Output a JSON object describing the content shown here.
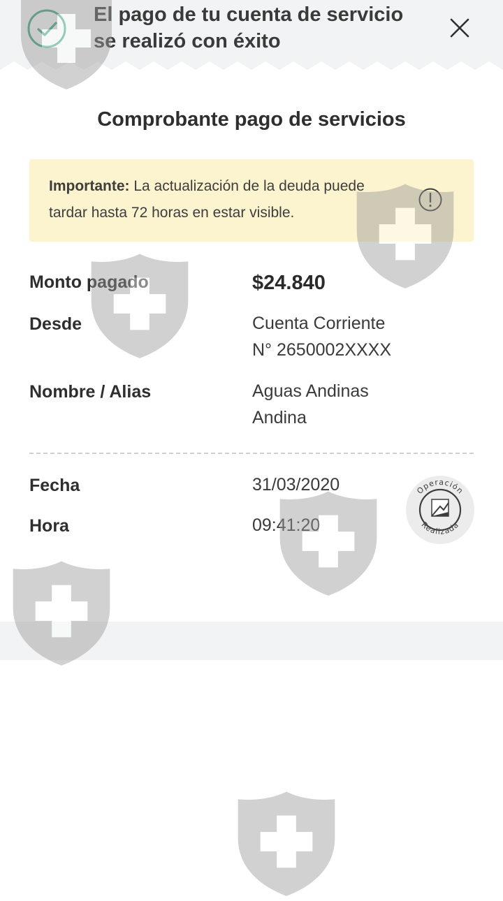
{
  "header": {
    "title_line1": "El pago de tu cuenta de servicio",
    "title_line2": "se realizó con éxito",
    "success_icon": "check-circle-icon",
    "close_icon": "close-icon"
  },
  "receipt": {
    "title": "Comprobante pago de servicios",
    "notice": {
      "bold": "Importante:",
      "text": " La actualización de la deuda puede tardar hasta 72 horas en estar visible.",
      "icon": "alert-circle-icon"
    },
    "amount": {
      "label": "Monto pagado",
      "value": "$24.840"
    },
    "from": {
      "label": "Desde",
      "line1": "Cuenta Corriente",
      "line2": "N° 2650002XXXX"
    },
    "name": {
      "label": "Nombre / Alias",
      "line1": "Aguas Andinas",
      "line2": "Andina"
    },
    "date": {
      "label": "Fecha",
      "value": "31/03/2020"
    },
    "time": {
      "label": "Hora",
      "value": "09:41:20"
    },
    "stamp": {
      "top_text": "Operación",
      "bottom_text": "Realizada",
      "icon": "operation-stamp-icon"
    }
  },
  "colors": {
    "success": "#3aa17e",
    "notice_bg": "#fcf3cf",
    "band": "#f2f3f4"
  }
}
